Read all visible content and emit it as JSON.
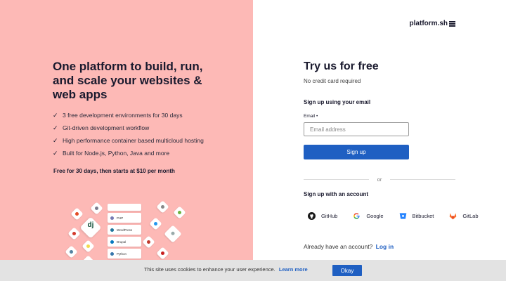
{
  "hero": {
    "title": "One platform to build, run, and scale your websites & web apps",
    "features": [
      "3 free development environments for 30 days",
      "Git-driven development workflow",
      "High performance container based multicloud hosting",
      "Built for Node.js, Python, Java and more"
    ],
    "pricing": "Free for 30 days, then starts at $10 per month"
  },
  "illustration": {
    "stack": [
      "PHP",
      "WordPress",
      "Drupal",
      "Python"
    ],
    "badge": "dj"
  },
  "brand": {
    "logo_text": "platform.sh"
  },
  "form": {
    "title": "Try us for free",
    "subtitle": "No credit card required",
    "email_heading": "Sign up using your email",
    "email_label": "Email •",
    "email_placeholder": "Email address",
    "email_value": "",
    "signup_label": "Sign up",
    "divider_text": "or",
    "account_heading": "Sign up with an account",
    "providers": [
      {
        "name": "GitHub",
        "icon": "github-icon",
        "color": "#1a1a1a"
      },
      {
        "name": "Google",
        "icon": "google-icon",
        "color": "#4285f4"
      },
      {
        "name": "Bitbucket",
        "icon": "bitbucket-icon",
        "color": "#2684ff"
      },
      {
        "name": "GitLab",
        "icon": "gitlab-icon",
        "color": "#fc6d26"
      }
    ],
    "login_prompt": "Already have an account?",
    "login_link": "Log in"
  },
  "cookie": {
    "text": "This site uses cookies to enhance your user experience.",
    "link": "Learn more",
    "ok_label": "Okay"
  },
  "colors": {
    "left_bg": "#fdb9b6",
    "accent": "#1f5fc2",
    "cookie_bg": "#e3e3e3"
  }
}
